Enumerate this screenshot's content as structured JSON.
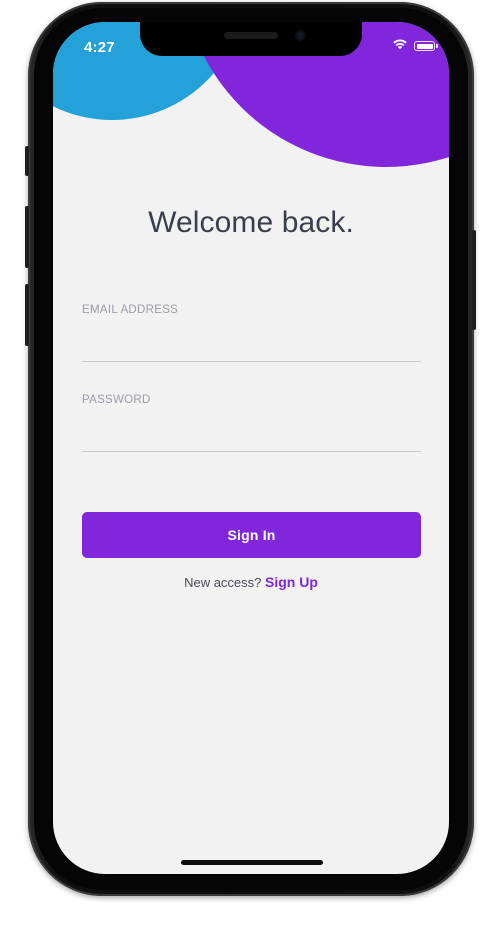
{
  "status_bar": {
    "time": "4:27",
    "wifi_icon": "wifi-icon",
    "battery_icon": "battery-icon"
  },
  "login": {
    "title": "Welcome back.",
    "email_label": "EMAIL ADDRESS",
    "email_value": "",
    "password_label": "PASSWORD",
    "password_value": "",
    "sign_in_label": "Sign In",
    "signup_prompt": "New access?",
    "signup_link": "Sign Up"
  },
  "colors": {
    "accent_purple": "#8226dc",
    "accent_blue": "#23a1d8",
    "background": "#f2f2f3"
  }
}
